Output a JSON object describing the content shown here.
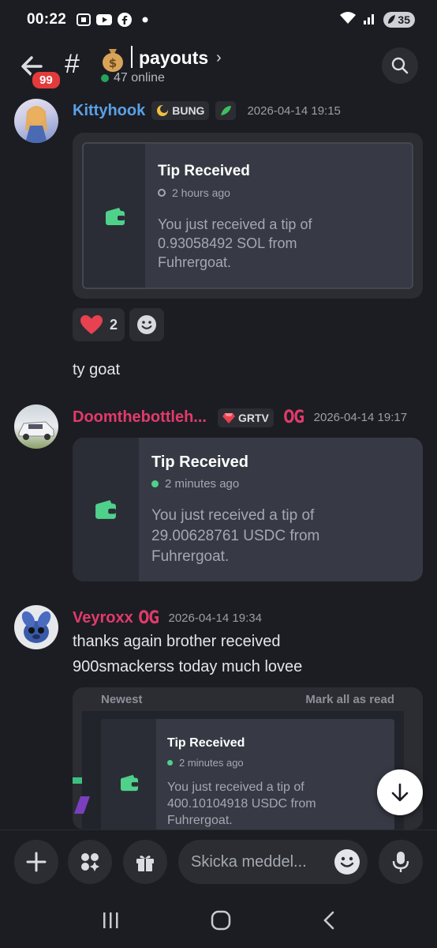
{
  "status": {
    "time": "00:22",
    "battery": "35",
    "icons": [
      "screenshot-icon",
      "youtube-icon",
      "facebook-icon",
      "dot-icon"
    ],
    "right_icons": [
      "wifi-icon",
      "signal-icon"
    ]
  },
  "header": {
    "unread_badge": "99",
    "hash": "#",
    "channel_emoji": "💰",
    "channel_name": "payouts",
    "chevron": "›",
    "online": "47 online"
  },
  "messages": [
    {
      "username": "Kittyhook",
      "username_color": "#5aa1e6",
      "tag": "BUNG",
      "timestamp": "2026-04-14 19:15",
      "card": {
        "title": "Tip Received",
        "time": "2 hours ago",
        "body_line1": "You just received a tip of",
        "body_line2": "0.93058492 SOL from",
        "body_line3": "Fuhrergoat."
      },
      "reactions": [
        {
          "emoji": "heart",
          "count": "2"
        }
      ],
      "followup": "ty goat"
    },
    {
      "username": "Doomthebottleh...",
      "username_color": "#e23b6b",
      "tag": "GRTV",
      "og": "OG",
      "timestamp": "2026-04-14 19:17",
      "card": {
        "title": "Tip Received",
        "time": "2 minutes ago",
        "body_line1": "You just received a tip of",
        "body_line2": "29.00628761 USDC from",
        "body_line3": "Fuhrergoat."
      }
    },
    {
      "username": "Veyroxx",
      "username_color": "#e23b6b",
      "og": "OG",
      "timestamp": "2026-04-14 19:34",
      "text_line1": "thanks again brother received",
      "text_line2": "900smackerss today much lovee",
      "screenshot": {
        "tab_left": "Newest",
        "tab_right": "Mark all as read",
        "title": "Tip Received",
        "time": "2 minutes ago",
        "body_line1": "You just received a tip of",
        "body_line2": "400.10104918 USDC from",
        "body_line3": "Fuhrergoat."
      }
    }
  ],
  "composer": {
    "placeholder": "Skicka meddel..."
  },
  "colors": {
    "background": "#1c1d22",
    "green": "#23a55a",
    "wallet_green": "#4fd18b",
    "og_red": "#e23b6b"
  }
}
